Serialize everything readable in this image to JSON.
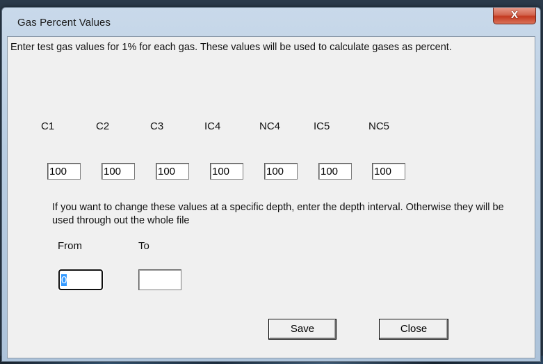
{
  "window": {
    "title": "Gas Percent Values",
    "close_glyph": "X"
  },
  "intro_text": "Enter test gas values for 1% for each gas. These values will be used to calculate gases as percent.",
  "gases": [
    {
      "label": "C1",
      "value": "100"
    },
    {
      "label": "C2",
      "value": "100"
    },
    {
      "label": "C3",
      "value": "100"
    },
    {
      "label": "IC4",
      "value": "100"
    },
    {
      "label": "NC4",
      "value": "100"
    },
    {
      "label": "IC5",
      "value": "100"
    },
    {
      "label": "NC5",
      "value": "100"
    }
  ],
  "depth": {
    "instruction": "If you want to change these values at a specific depth, enter the depth interval. Otherwise they will be used  through out the whole file",
    "from_label": "From",
    "to_label": "To",
    "from_value": "0",
    "to_value": ""
  },
  "buttons": {
    "save": "Save",
    "close": "Close"
  },
  "colors": {
    "close_button": "#c43a21",
    "dialog_background": "#f0f0f0",
    "selection": "#3399ff"
  }
}
